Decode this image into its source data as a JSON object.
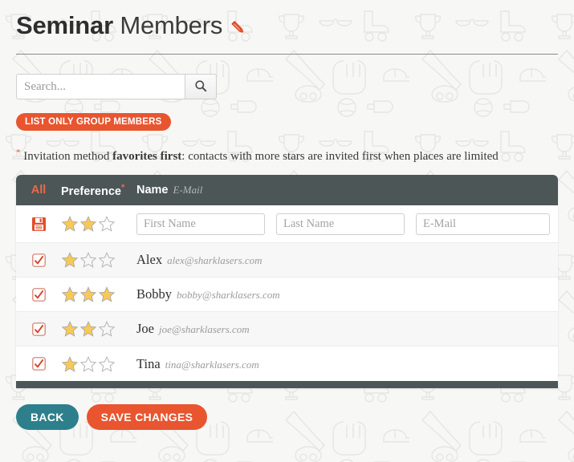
{
  "title": {
    "strong": "Seminar",
    "rest": " Members",
    "edit_icon": "pencil-icon"
  },
  "search": {
    "placeholder": "Search...",
    "value": "",
    "button_icon": "search-icon"
  },
  "group_button": {
    "label": "LIST ONLY GROUP MEMBERS"
  },
  "note": {
    "asterisk": "*",
    "lead": "Invitation method ",
    "bold": "favorites first",
    "tail": ": contacts with more stars are invited first when places are limited"
  },
  "table": {
    "headers": {
      "all": "All",
      "preference": "Preference",
      "preference_asterisk": "*",
      "name": "Name",
      "email": "E-Mail"
    },
    "new_row": {
      "save_icon": "floppy-disk-icon",
      "stars_filled": 2,
      "stars_total": 3,
      "first_name": {
        "placeholder": "First Name",
        "value": ""
      },
      "last_name": {
        "placeholder": "Last Name",
        "value": ""
      },
      "email": {
        "placeholder": "E-Mail",
        "value": ""
      }
    },
    "rows": [
      {
        "checked": true,
        "stars_filled": 1,
        "stars_total": 3,
        "name": "Alex",
        "email": "alex@sharklasers.com"
      },
      {
        "checked": true,
        "stars_filled": 3,
        "stars_total": 3,
        "name": "Bobby",
        "email": "bobby@sharklasers.com"
      },
      {
        "checked": true,
        "stars_filled": 2,
        "stars_total": 3,
        "name": "Joe",
        "email": "joe@sharklasers.com"
      },
      {
        "checked": true,
        "stars_filled": 1,
        "stars_total": 3,
        "name": "Tina",
        "email": "tina@sharklasers.com"
      }
    ]
  },
  "footer_buttons": {
    "back": "BACK",
    "save": "SAVE CHANGES"
  },
  "colors": {
    "accent_orange": "#e8552f",
    "teal": "#2d7f8c",
    "header_dark": "#4c5657",
    "star_gold": "#f5c councils"
  }
}
